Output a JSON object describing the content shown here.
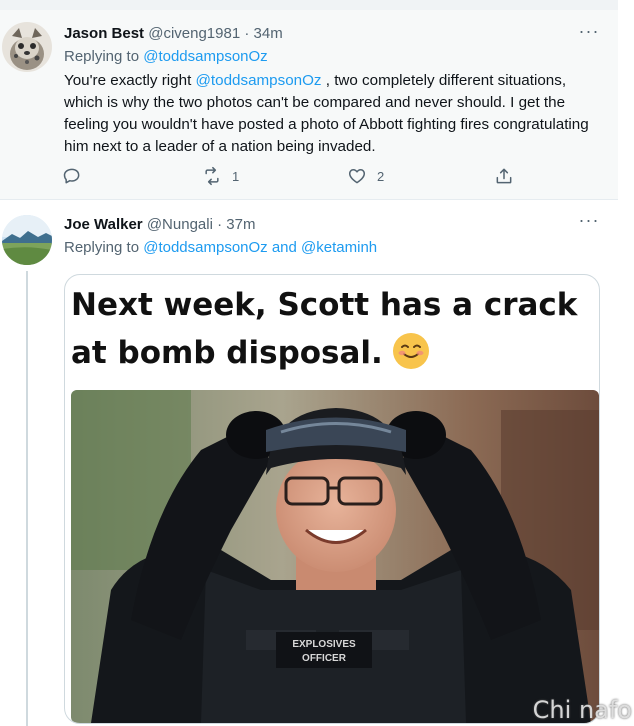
{
  "tweets": [
    {
      "name": "Jason Best",
      "handle": "@civeng1981",
      "sep": "·",
      "time": "34m",
      "replying_prefix": "Replying to ",
      "replying_to": "@toddsampsonOz",
      "text_prefix": "You're exactly right ",
      "text_mention": "@toddsampsonOz",
      "text_rest": " , two completely different situations, which is why the two photos can't be compared and never should. I get the feeling you wouldn't have posted a photo of Abbott fighting fires congratulating him next to a leader of a nation being invaded.",
      "retweets": "1",
      "likes": "2",
      "more": "···"
    },
    {
      "name": "Joe Walker",
      "handle": "@Nungali",
      "sep": "·",
      "time": "37m",
      "replying_prefix": "Replying to ",
      "replying_to": "@toddsampsonOz",
      "replying_and": " and ",
      "replying_to_2": "@ketaminh",
      "more": "···",
      "meme_caption": "Next week, Scott has a crack at bomb disposal.",
      "vest_label_1": "EXPLOSIVES",
      "vest_label_2": "OFFICER"
    }
  ],
  "watermark": "Chi nafo",
  "icons": {
    "reply": "reply-icon",
    "retweet": "retweet-icon",
    "like": "heart-icon",
    "share": "share-icon"
  },
  "colors": {
    "link": "#1d9bf0",
    "muted": "#536471",
    "text": "#0f1419"
  }
}
